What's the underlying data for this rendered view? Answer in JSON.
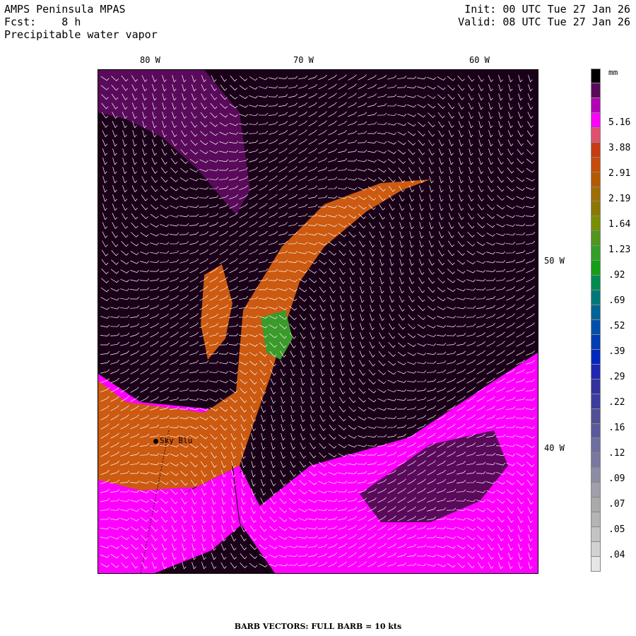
{
  "header": {
    "model": "AMPS Peninsula MPAS",
    "forecast_hour": "Fcst:    8 h",
    "field": "Precipitable water vapor",
    "init": "Init: 00 UTC Tue 27 Jan 26",
    "valid": "Valid: 08 UTC Tue 27 Jan 26"
  },
  "map": {
    "lon_labels": [
      "80 W",
      "70 W",
      "60 W"
    ],
    "lat_labels": [
      "50 W",
      "40 W"
    ],
    "station": "Sky Blu",
    "colors": {
      "background": "#1a0018",
      "low": "#5a0a5a",
      "mid_low": "#a000a0",
      "mid": "#ff00ff",
      "high_orange": "#cc5a10",
      "high_green": "#3a9a2a"
    }
  },
  "colorbar": {
    "unit": "mm",
    "labels": [
      "5.16",
      "3.88",
      "2.91",
      "2.19",
      "1.64",
      "1.23",
      ".92",
      ".69",
      ".52",
      ".39",
      ".29",
      ".22",
      ".16",
      ".12",
      ".09",
      ".07",
      ".05",
      ".04"
    ],
    "colors": [
      "#000000",
      "#5a0a5a",
      "#b400b4",
      "#ff00ff",
      "#e0506e",
      "#c83c14",
      "#c84b0a",
      "#b45a00",
      "#a06e00",
      "#8c7800",
      "#789000",
      "#50961e",
      "#32a028",
      "#14a014",
      "#008c50",
      "#007878",
      "#006496",
      "#0050aa",
      "#003cb4",
      "#0028be",
      "#1e28b4",
      "#3232a0",
      "#3c3ca0",
      "#505096",
      "#5a5a9b",
      "#6e6ea0",
      "#7878a0",
      "#8c8ca5",
      "#a0a0aa",
      "#aaaaaa",
      "#b4b4b4",
      "#c3c3c3",
      "#d2d2d2",
      "#e6e6e6"
    ]
  },
  "footer": "BARB VECTORS:  FULL BARB = 10 kts"
}
